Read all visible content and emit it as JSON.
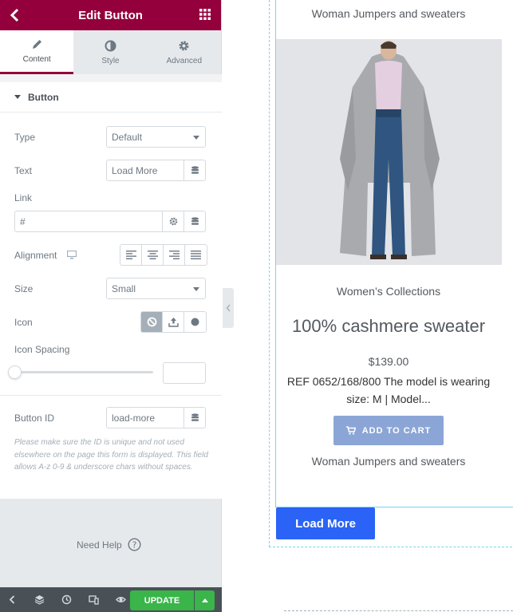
{
  "panel": {
    "title": "Edit Button",
    "tabs": [
      {
        "label": "Content",
        "active": true
      },
      {
        "label": "Style",
        "active": false
      },
      {
        "label": "Advanced",
        "active": false
      }
    ],
    "section_title": "Button",
    "type": {
      "label": "Type",
      "value": "Default"
    },
    "text": {
      "label": "Text",
      "value": "Load More"
    },
    "link": {
      "label": "Link",
      "value": "#"
    },
    "alignment": {
      "label": "Alignment"
    },
    "size": {
      "label": "Size",
      "value": "Small"
    },
    "icon": {
      "label": "Icon"
    },
    "icon_spacing": {
      "label": "Icon Spacing",
      "value": ""
    },
    "button_id": {
      "label": "Button ID",
      "value": "load-more"
    },
    "note": "Please make sure the ID is unique and not used elsewhere on the page this form is displayed. This field allows A-z 0-9 & underscore chars without spaces.",
    "need_help": "Need Help",
    "update_label": "UPDATE"
  },
  "colors": {
    "header": "#93003c",
    "update": "#39b54a",
    "load_more": "#2a63f5",
    "add_to_cart": "#8ba6d6"
  },
  "preview": {
    "top_category": "Woman Jumpers and sweaters",
    "collection": "Women’s Collections",
    "product_title": "100% cashmere sweater",
    "price": "$139.00",
    "description": "REF 0652/168/800 The model is wearing size: M | Model...",
    "add_to_cart": "ADD TO CART",
    "bottom_category": "Woman Jumpers and sweaters",
    "load_more": "Load More"
  }
}
